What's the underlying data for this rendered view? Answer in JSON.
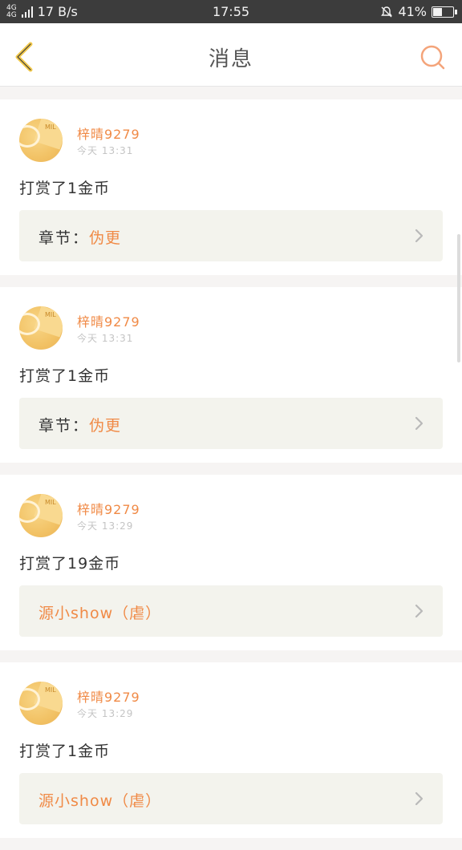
{
  "status": {
    "network_top": "4G",
    "network_bottom": "4G",
    "speed": "17 B/s",
    "time": "17:55",
    "battery": "41%"
  },
  "header": {
    "title": "消息"
  },
  "icons": {
    "back": "chevron-left-icon",
    "search": "search-icon",
    "bell_muted": "bell-off-icon",
    "chevron": "chevron-right-icon"
  },
  "colors": {
    "accent": "#f08a46",
    "back_icon": "#f2c94c"
  },
  "messages": [
    {
      "user": "梓晴9279",
      "time": "今天 13:31",
      "text": "打赏了1金币",
      "chapter_prefix": "章节：",
      "chapter": "伪更"
    },
    {
      "user": "梓晴9279",
      "time": "今天 13:31",
      "text": "打赏了1金币",
      "chapter_prefix": "章节：",
      "chapter": "伪更"
    },
    {
      "user": "梓晴9279",
      "time": "今天 13:29",
      "text": "打赏了19金币",
      "chapter_prefix": "",
      "chapter": "源小show（虐）"
    },
    {
      "user": "梓晴9279",
      "time": "今天 13:29",
      "text": "打赏了1金币",
      "chapter_prefix": "",
      "chapter": "源小show（虐）"
    }
  ]
}
